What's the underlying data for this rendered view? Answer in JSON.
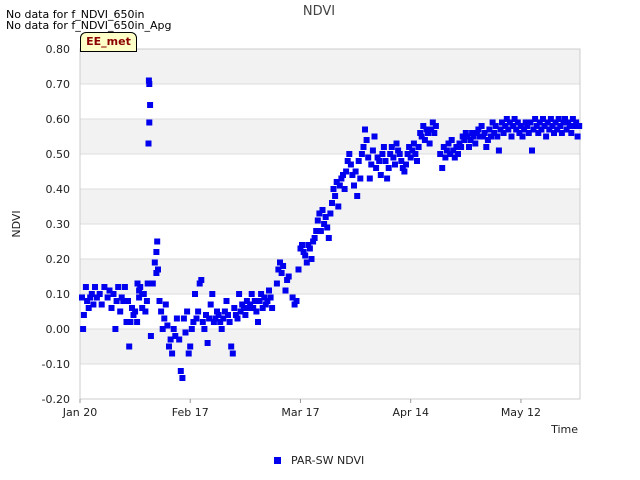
{
  "notes": [
    "No data for f_NDVI_650in",
    "No data for f_NDVI_650in_Apg"
  ],
  "badge": "EE_met",
  "colors": {
    "series": "#0000ee",
    "band": "#f2f2f2",
    "grid": "#dddddd"
  },
  "chart_data": {
    "type": "scatter",
    "title": "NDVI",
    "xlabel": "Time",
    "ylabel": "NDVI",
    "ylim": [
      -0.2,
      0.8
    ],
    "yticks": [
      "0.80",
      "0.70",
      "0.60",
      "0.50",
      "0.40",
      "0.30",
      "0.20",
      "0.10",
      "0.00",
      "-0.10",
      "-0.20"
    ],
    "xticks": [
      {
        "label": "Jan 20",
        "day": 0
      },
      {
        "label": "Feb 17",
        "day": 28
      },
      {
        "label": "Mar 17",
        "day": 56
      },
      {
        "label": "Apr 14",
        "day": 84
      },
      {
        "label": "May 12",
        "day": 112
      }
    ],
    "xlim_days": [
      0,
      127
    ],
    "legend": "bottom-center",
    "grid": true,
    "series": [
      {
        "name": "PAR-SW NDVI",
        "points": [
          [
            0.5,
            0.09
          ],
          [
            0.8,
            0.0
          ],
          [
            1.0,
            0.04
          ],
          [
            1.5,
            0.12
          ],
          [
            1.8,
            0.08
          ],
          [
            2.2,
            0.06
          ],
          [
            2.6,
            0.09
          ],
          [
            3.0,
            0.1
          ],
          [
            3.4,
            0.07
          ],
          [
            3.8,
            0.12
          ],
          [
            4.3,
            0.09
          ],
          [
            5.0,
            0.1
          ],
          [
            5.5,
            0.07
          ],
          [
            6.2,
            0.12
          ],
          [
            7.0,
            0.09
          ],
          [
            7.5,
            0.11
          ],
          [
            8.0,
            0.06
          ],
          [
            8.5,
            0.1
          ],
          [
            9.0,
            0.0
          ],
          [
            9.3,
            0.08
          ],
          [
            9.7,
            0.12
          ],
          [
            10.2,
            0.05
          ],
          [
            10.6,
            0.09
          ],
          [
            11.0,
            0.08
          ],
          [
            11.4,
            0.12
          ],
          [
            11.8,
            0.02
          ],
          [
            12.2,
            0.08
          ],
          [
            12.5,
            -0.05
          ],
          [
            12.8,
            0.02
          ],
          [
            13.2,
            0.06
          ],
          [
            13.6,
            0.04
          ],
          [
            14.0,
            0.05
          ],
          [
            14.5,
            0.02
          ],
          [
            15.0,
            0.09
          ],
          [
            15.3,
            0.12
          ],
          [
            15.8,
            0.1
          ],
          [
            17.5,
            0.71
          ],
          [
            17.6,
            0.7
          ],
          [
            17.8,
            0.64
          ],
          [
            17.6,
            0.59
          ],
          [
            17.4,
            0.53
          ],
          [
            17.2,
            0.13
          ],
          [
            17.0,
            0.08
          ],
          [
            16.6,
            0.05
          ],
          [
            16.2,
            0.1
          ],
          [
            15.8,
            0.06
          ],
          [
            15.0,
            0.11
          ],
          [
            14.6,
            0.13
          ],
          [
            18.0,
            -0.02
          ],
          [
            18.5,
            0.13
          ],
          [
            19.0,
            0.19
          ],
          [
            19.4,
            0.22
          ],
          [
            19.6,
            0.25
          ],
          [
            19.8,
            0.17
          ],
          [
            19.4,
            0.16
          ],
          [
            20.2,
            0.08
          ],
          [
            20.6,
            0.05
          ],
          [
            21.0,
            0.0
          ],
          [
            21.4,
            0.03
          ],
          [
            21.8,
            0.07
          ],
          [
            22.2,
            0.01
          ],
          [
            22.6,
            -0.05
          ],
          [
            23.0,
            -0.03
          ],
          [
            23.4,
            -0.07
          ],
          [
            23.8,
            0.0
          ],
          [
            24.2,
            -0.02
          ],
          [
            24.6,
            0.03
          ],
          [
            25.2,
            -0.03
          ],
          [
            25.6,
            -0.12
          ],
          [
            26.0,
            -0.14
          ],
          [
            26.4,
            0.03
          ],
          [
            26.8,
            -0.01
          ],
          [
            27.2,
            0.05
          ],
          [
            27.6,
            -0.07
          ],
          [
            28.0,
            -0.05
          ],
          [
            28.4,
            0.0
          ],
          [
            28.8,
            0.02
          ],
          [
            29.2,
            0.1
          ],
          [
            29.6,
            0.03
          ],
          [
            30.0,
            0.05
          ],
          [
            30.4,
            0.13
          ],
          [
            30.8,
            0.14
          ],
          [
            31.2,
            0.02
          ],
          [
            31.6,
            0.0
          ],
          [
            32.0,
            0.04
          ],
          [
            32.4,
            -0.04
          ],
          [
            32.8,
            0.03
          ],
          [
            33.2,
            0.07
          ],
          [
            33.6,
            0.1
          ],
          [
            34.0,
            0.02
          ],
          [
            34.4,
            0.03
          ],
          [
            34.8,
            0.05
          ],
          [
            35.2,
            0.04
          ],
          [
            35.6,
            0.02
          ],
          [
            36.0,
            0.0
          ],
          [
            36.4,
            0.03
          ],
          [
            36.8,
            0.05
          ],
          [
            37.2,
            0.08
          ],
          [
            37.6,
            0.04
          ],
          [
            38.0,
            0.02
          ],
          [
            38.4,
            -0.05
          ],
          [
            38.8,
            -0.07
          ],
          [
            39.2,
            0.06
          ],
          [
            39.6,
            0.04
          ],
          [
            40.0,
            0.03
          ],
          [
            40.4,
            0.1
          ],
          [
            40.8,
            0.05
          ],
          [
            41.2,
            0.07
          ],
          [
            41.6,
            0.06
          ],
          [
            42.0,
            0.04
          ],
          [
            42.4,
            0.08
          ],
          [
            42.8,
            0.06
          ],
          [
            43.2,
            0.07
          ],
          [
            43.6,
            0.1
          ],
          [
            44.0,
            0.06
          ],
          [
            44.4,
            0.08
          ],
          [
            44.8,
            0.05
          ],
          [
            45.2,
            0.02
          ],
          [
            45.6,
            0.08
          ],
          [
            46.0,
            0.1
          ],
          [
            46.4,
            0.06
          ],
          [
            46.8,
            0.09
          ],
          [
            47.2,
            0.07
          ],
          [
            47.6,
            0.08
          ],
          [
            48.0,
            0.11
          ],
          [
            48.4,
            0.09
          ],
          [
            48.8,
            0.06
          ],
          [
            50.0,
            0.13
          ],
          [
            50.4,
            0.17
          ],
          [
            50.8,
            0.19
          ],
          [
            51.2,
            0.16
          ],
          [
            51.6,
            0.18
          ],
          [
            52.2,
            0.11
          ],
          [
            52.6,
            0.14
          ],
          [
            53.0,
            0.15
          ],
          [
            54.0,
            0.09
          ],
          [
            54.5,
            0.07
          ],
          [
            55.0,
            0.08
          ],
          [
            55.5,
            0.17
          ],
          [
            56.0,
            0.23
          ],
          [
            56.4,
            0.24
          ],
          [
            56.8,
            0.22
          ],
          [
            57.2,
            0.21
          ],
          [
            57.6,
            0.19
          ],
          [
            58.0,
            0.24
          ],
          [
            58.4,
            0.23
          ],
          [
            58.8,
            0.2
          ],
          [
            59.2,
            0.25
          ],
          [
            59.6,
            0.26
          ],
          [
            60.0,
            0.28
          ],
          [
            60.4,
            0.31
          ],
          [
            60.8,
            0.33
          ],
          [
            61.2,
            0.28
          ],
          [
            61.6,
            0.34
          ],
          [
            62.0,
            0.3
          ],
          [
            62.4,
            0.32
          ],
          [
            62.8,
            0.29
          ],
          [
            63.2,
            0.26
          ],
          [
            63.6,
            0.33
          ],
          [
            64.0,
            0.36
          ],
          [
            64.4,
            0.4
          ],
          [
            64.8,
            0.38
          ],
          [
            65.2,
            0.42
          ],
          [
            65.6,
            0.35
          ],
          [
            66.0,
            0.41
          ],
          [
            66.4,
            0.43
          ],
          [
            66.8,
            0.44
          ],
          [
            67.2,
            0.4
          ],
          [
            67.6,
            0.45
          ],
          [
            68.0,
            0.48
          ],
          [
            68.4,
            0.5
          ],
          [
            68.8,
            0.47
          ],
          [
            69.2,
            0.44
          ],
          [
            69.6,
            0.41
          ],
          [
            70.0,
            0.45
          ],
          [
            70.4,
            0.38
          ],
          [
            70.8,
            0.48
          ],
          [
            71.2,
            0.43
          ],
          [
            71.6,
            0.5
          ],
          [
            72.0,
            0.52
          ],
          [
            72.4,
            0.57
          ],
          [
            72.8,
            0.54
          ],
          [
            73.2,
            0.49
          ],
          [
            73.6,
            0.43
          ],
          [
            74.0,
            0.47
          ],
          [
            74.4,
            0.51
          ],
          [
            74.8,
            0.55
          ],
          [
            75.2,
            0.46
          ],
          [
            75.6,
            0.49
          ],
          [
            76.0,
            0.48
          ],
          [
            76.4,
            0.44
          ],
          [
            76.8,
            0.5
          ],
          [
            77.2,
            0.52
          ],
          [
            77.6,
            0.48
          ],
          [
            78.0,
            0.43
          ],
          [
            78.4,
            0.46
          ],
          [
            78.8,
            0.5
          ],
          [
            79.2,
            0.52
          ],
          [
            79.6,
            0.49
          ],
          [
            80.0,
            0.47
          ],
          [
            80.4,
            0.53
          ],
          [
            80.8,
            0.51
          ],
          [
            81.2,
            0.5
          ],
          [
            81.6,
            0.48
          ],
          [
            82.0,
            0.46
          ],
          [
            82.4,
            0.45
          ],
          [
            82.8,
            0.47
          ],
          [
            83.2,
            0.5
          ],
          [
            83.6,
            0.52
          ],
          [
            84.0,
            0.49
          ],
          [
            84.4,
            0.51
          ],
          [
            84.8,
            0.53
          ],
          [
            85.2,
            0.5
          ],
          [
            85.6,
            0.48
          ],
          [
            86.0,
            0.52
          ],
          [
            86.4,
            0.56
          ],
          [
            86.8,
            0.55
          ],
          [
            87.2,
            0.58
          ],
          [
            87.6,
            0.54
          ],
          [
            88.0,
            0.57
          ],
          [
            88.4,
            0.56
          ],
          [
            88.8,
            0.53
          ],
          [
            89.2,
            0.57
          ],
          [
            89.6,
            0.59
          ],
          [
            90.0,
            0.56
          ],
          [
            90.4,
            0.58
          ],
          [
            91.5,
            0.5
          ],
          [
            92.0,
            0.46
          ],
          [
            92.4,
            0.52
          ],
          [
            92.8,
            0.49
          ],
          [
            93.2,
            0.51
          ],
          [
            93.6,
            0.53
          ],
          [
            94.0,
            0.5
          ],
          [
            94.4,
            0.54
          ],
          [
            94.8,
            0.51
          ],
          [
            95.2,
            0.49
          ],
          [
            95.6,
            0.52
          ],
          [
            96.0,
            0.5
          ],
          [
            96.4,
            0.53
          ],
          [
            96.8,
            0.52
          ],
          [
            97.2,
            0.55
          ],
          [
            97.6,
            0.54
          ],
          [
            98.0,
            0.56
          ],
          [
            98.4,
            0.55
          ],
          [
            98.8,
            0.52
          ],
          [
            99.2,
            0.54
          ],
          [
            99.6,
            0.56
          ],
          [
            100.0,
            0.55
          ],
          [
            100.4,
            0.53
          ],
          [
            100.8,
            0.56
          ],
          [
            101.2,
            0.57
          ],
          [
            101.6,
            0.55
          ],
          [
            102.0,
            0.58
          ],
          [
            102.4,
            0.55
          ],
          [
            102.8,
            0.56
          ],
          [
            103.2,
            0.52
          ],
          [
            103.6,
            0.54
          ],
          [
            104.0,
            0.57
          ],
          [
            104.4,
            0.55
          ],
          [
            104.8,
            0.59
          ],
          [
            105.2,
            0.56
          ],
          [
            105.6,
            0.58
          ],
          [
            106.0,
            0.55
          ],
          [
            106.4,
            0.51
          ],
          [
            106.8,
            0.57
          ],
          [
            107.2,
            0.59
          ],
          [
            107.6,
            0.56
          ],
          [
            108.0,
            0.58
          ],
          [
            108.4,
            0.6
          ],
          [
            108.8,
            0.57
          ],
          [
            109.2,
            0.59
          ],
          [
            109.6,
            0.55
          ],
          [
            110.0,
            0.58
          ],
          [
            110.4,
            0.6
          ],
          [
            110.8,
            0.57
          ],
          [
            111.2,
            0.59
          ],
          [
            111.6,
            0.56
          ],
          [
            112.0,
            0.58
          ],
          [
            112.4,
            0.55
          ],
          [
            112.8,
            0.57
          ],
          [
            113.2,
            0.59
          ],
          [
            113.6,
            0.58
          ],
          [
            114.0,
            0.56
          ],
          [
            114.4,
            0.59
          ],
          [
            114.8,
            0.51
          ],
          [
            115.2,
            0.57
          ],
          [
            115.6,
            0.6
          ],
          [
            116.0,
            0.58
          ],
          [
            116.4,
            0.56
          ],
          [
            116.8,
            0.59
          ],
          [
            117.2,
            0.57
          ],
          [
            117.6,
            0.6
          ],
          [
            118.0,
            0.58
          ],
          [
            118.4,
            0.55
          ],
          [
            118.8,
            0.59
          ],
          [
            119.2,
            0.57
          ],
          [
            119.6,
            0.6
          ],
          [
            120.0,
            0.58
          ],
          [
            120.4,
            0.56
          ],
          [
            120.8,
            0.59
          ],
          [
            121.2,
            0.57
          ],
          [
            121.6,
            0.6
          ],
          [
            122.0,
            0.58
          ],
          [
            122.4,
            0.56
          ],
          [
            122.8,
            0.59
          ],
          [
            123.2,
            0.6
          ],
          [
            123.6,
            0.57
          ],
          [
            124.0,
            0.59
          ],
          [
            124.4,
            0.58
          ],
          [
            124.8,
            0.56
          ],
          [
            125.2,
            0.6
          ],
          [
            125.6,
            0.58
          ],
          [
            126.0,
            0.59
          ],
          [
            126.4,
            0.55
          ],
          [
            126.8,
            0.58
          ]
        ]
      }
    ]
  }
}
